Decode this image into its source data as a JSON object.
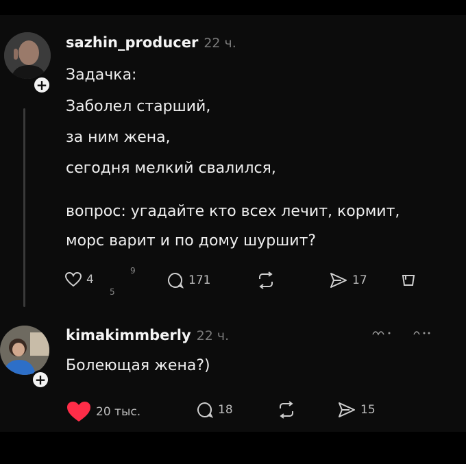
{
  "post": {
    "username": "sazhin_producer",
    "time": "22 ч.",
    "lines": [
      "Задачка:",
      "Заболел старший,",
      "за ним жена,",
      "сегодня мелкий свалился,",
      "вопрос: угадайте кто всех лечит, кормит,",
      "морс варит и по дому шуршит?"
    ],
    "likes": "4",
    "like_sup": "9",
    "like_sub": "5",
    "comments": "171",
    "reposts": "",
    "shares": "17"
  },
  "reply": {
    "username": "kimakimmberly",
    "time": "22 ч.",
    "text": "Болеющая жена?)",
    "likes": "20 тыс.",
    "comments": "18",
    "shares": "15"
  },
  "colors": {
    "like_red": "#ff2d48",
    "background": "#0c0c0c",
    "muted": "#7a7a7a"
  }
}
